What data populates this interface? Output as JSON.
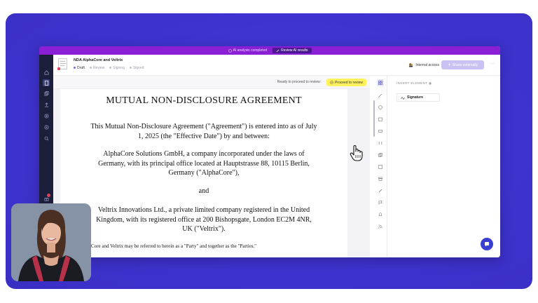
{
  "topbar": {
    "status_text": "AI analysis completed",
    "review_button": "Review AI results"
  },
  "document": {
    "title": "NDA AlphaCore and Veltrix",
    "steps": [
      {
        "label": "Draft",
        "current": true
      },
      {
        "label": "Review",
        "current": false
      },
      {
        "label": "Signing",
        "current": false
      },
      {
        "label": "Signed",
        "current": false
      }
    ]
  },
  "header": {
    "access_label": "Internal access",
    "share_label": "Share externally",
    "more_label": "···"
  },
  "reviewbar": {
    "text": "Ready to proceed to review:",
    "button": "Proceed to review"
  },
  "content": {
    "heading": "MUTUAL NON-DISCLOSURE AGREEMENT",
    "intro_1": "This Mutual Non-Disclosure Agreement (\"Agreement\") is entered into as of July",
    "intro_2": "1, 2025 (the \"Effective Date\") by and between:",
    "party1_1": "AlphaCore Solutions GmbH, a company incorporated under the laws of",
    "party1_2": "Germany, with its principal office located at Hauptstrasse 88, 10115 Berlin,",
    "party1_3": "Germany (\"AlphaCore\"),",
    "and": "and",
    "party2_1": "Veltrix Innovations Ltd., a private limited company registered in the United",
    "party2_2": "Kingdom, with its registered office at 200 Bishopsgate, London EC2M 4NR,",
    "party2_3": "UK (\"Veltrix\").",
    "each": "Each of AlphaCore and Veltrix may be referred to herein as a \"Party\" and together as the \"Parties.\""
  },
  "panel": {
    "title": "INSERT ELEMENT",
    "signature_label": "Signature"
  },
  "colors": {
    "background": "#3e33cf",
    "topbar": "#8b1fd6",
    "sidebar": "#1c1f3a",
    "review_button": "#fff25e",
    "share_button": "#c9c2f3",
    "chat_button": "#3a3fd0"
  }
}
